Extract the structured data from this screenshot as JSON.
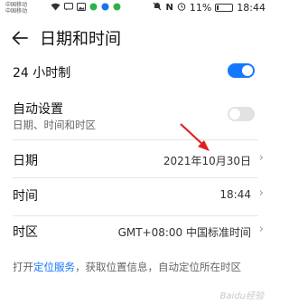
{
  "status_bar": {
    "carrier_1": "中国移动",
    "carrier_2": "中国移动",
    "battery_level": "11%",
    "time": "18:44",
    "icons": [
      "signal-icon",
      "wifi-icon",
      "message-icon",
      "photo-icon",
      "app-icon",
      "app-icon",
      "app-icon",
      "mute-icon",
      "nfc-icon",
      "alarm-icon"
    ]
  },
  "header": {
    "title": "日期和时间"
  },
  "settings": {
    "hour24": {
      "label": "24 小时制",
      "enabled": true
    },
    "auto": {
      "label": "自动设置",
      "sub": "日期、时间和时区",
      "enabled": false
    },
    "date": {
      "label": "日期",
      "value": "2021年10月30日"
    },
    "time": {
      "label": "时间",
      "value": "18:44"
    },
    "timezone": {
      "label": "时区",
      "value": "GMT+08:00 中国标准时间"
    }
  },
  "footer": {
    "prefix": "打开",
    "link": "定位服务",
    "suffix": "，获取位置信息，自动定位所在时区"
  },
  "watermark": "Baidu经验",
  "colors": {
    "accent": "#1677ff",
    "annotation_arrow": "#e02020"
  }
}
